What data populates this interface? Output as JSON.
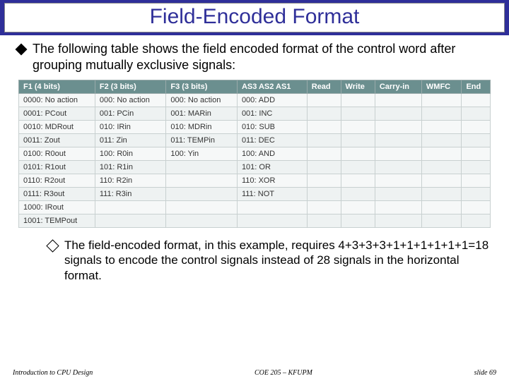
{
  "title": "Field-Encoded Format",
  "intro": "The following table shows the field encoded format of the control word after grouping mutually exclusive signals:",
  "headers": [
    "F1 (4 bits)",
    "F2 (3 bits)",
    "F3 (3 bits)",
    "AS3 AS2 AS1",
    "Read",
    "Write",
    "Carry-in",
    "WMFC",
    "End"
  ],
  "rows": [
    [
      "0000: No action",
      "000: No action",
      "000: No action",
      "000: ADD",
      "",
      "",
      "",
      "",
      ""
    ],
    [
      "0001: PCout",
      "001: PCin",
      "001: MARin",
      "001: INC",
      "",
      "",
      "",
      "",
      ""
    ],
    [
      "0010: MDRout",
      "010: IRin",
      "010: MDRin",
      "010: SUB",
      "",
      "",
      "",
      "",
      ""
    ],
    [
      "0011: Zout",
      "011: Zin",
      "011: TEMPin",
      "011: DEC",
      "",
      "",
      "",
      "",
      ""
    ],
    [
      "0100: R0out",
      "100: R0in",
      "100: Yin",
      "100: AND",
      "",
      "",
      "",
      "",
      ""
    ],
    [
      "0101: R1out",
      "101: R1in",
      "",
      "101: OR",
      "",
      "",
      "",
      "",
      ""
    ],
    [
      "0110: R2out",
      "110: R2in",
      "",
      "110: XOR",
      "",
      "",
      "",
      "",
      ""
    ],
    [
      "0111: R3out",
      "111: R3in",
      "",
      "111: NOT",
      "",
      "",
      "",
      "",
      ""
    ],
    [
      "1000: IRout",
      "",
      "",
      "",
      "",
      "",
      "",
      "",
      ""
    ],
    [
      "1001: TEMPout",
      "",
      "",
      "",
      "",
      "",
      "",
      "",
      ""
    ]
  ],
  "sub": "The field-encoded format, in this example, requires 4+3+3+3+1+1+1+1+1+1=18 signals to encode the control signals instead of 28 signals in the horizontal format.",
  "footer_left": "Introduction to CPU Design",
  "footer_center": "COE 205 – KFUPM",
  "footer_right": "slide 69",
  "chart_data": {
    "type": "table",
    "title": "Field-Encoded Format control word fields",
    "columns": [
      "F1 (4 bits)",
      "F2 (3 bits)",
      "F3 (3 bits)",
      "AS3 AS2 AS1",
      "Read",
      "Write",
      "Carry-in",
      "WMFC",
      "End"
    ],
    "note": "4+3+3+3+1+1+1+1+1+1 = 18 signals vs 28 horizontal"
  }
}
